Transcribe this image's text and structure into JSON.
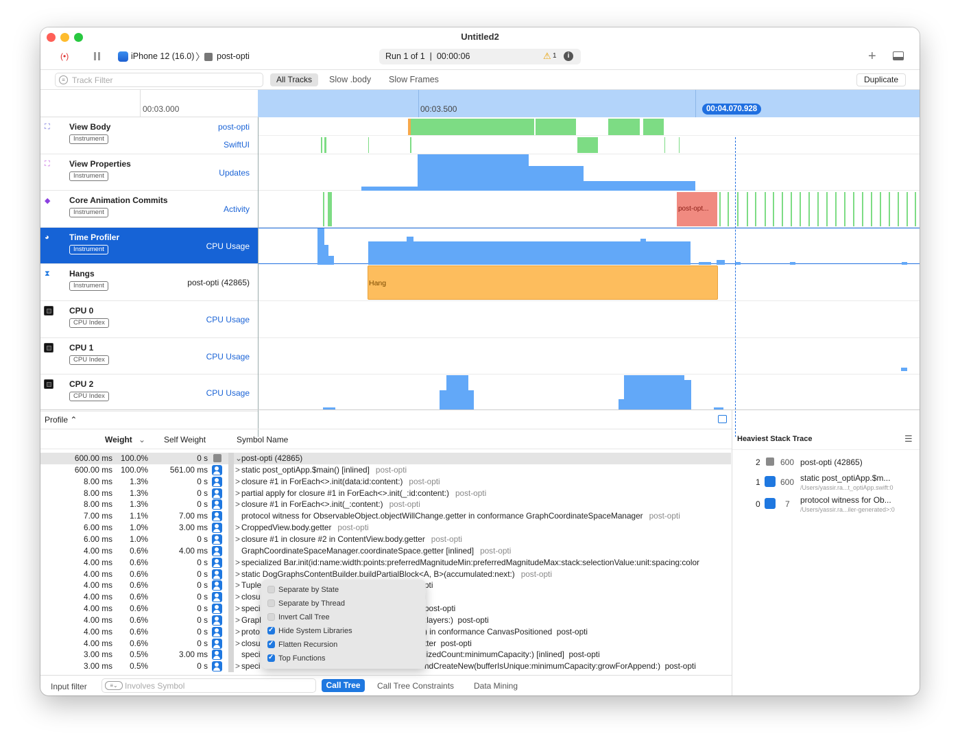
{
  "window": {
    "title": "Untitled2"
  },
  "toolbar": {
    "record_glyph": "(•)",
    "device": "iPhone 12 (16.0)",
    "target": "post-opti",
    "run_status": "Run 1 of 1  |  00:00:06",
    "warning_count": "1",
    "add_glyph": "+"
  },
  "filter": {
    "placeholder": "Track Filter",
    "scopes": [
      "All Tracks",
      "Slow .body",
      "Slow Frames"
    ],
    "duplicate": "Duplicate"
  },
  "ruler": {
    "ticks": [
      "00:03.000",
      "00:03.500"
    ],
    "playhead": "00:04.070.928"
  },
  "tracks": [
    {
      "name": "View Body",
      "badge": "Instrument",
      "sub1": "post-opti",
      "sub2": "SwiftUI",
      "icon": "view-body-icon"
    },
    {
      "name": "View Properties",
      "badge": "Instrument",
      "sub1": "Updates",
      "icon": "view-properties-icon"
    },
    {
      "name": "Core Animation Commits",
      "badge": "Instrument",
      "sub1": "Activity",
      "icon": "core-animation-icon"
    },
    {
      "name": "Time Profiler",
      "badge": "Instrument",
      "sub1": "CPU Usage",
      "icon": "time-profiler-icon"
    },
    {
      "name": "Hangs",
      "badge": "Instrument",
      "sub1": "post-opti (42865)",
      "icon": "hangs-icon"
    },
    {
      "name": "CPU 0",
      "badge": "CPU Index",
      "sub1": "CPU Usage",
      "icon": "cpu-icon"
    },
    {
      "name": "CPU 1",
      "badge": "CPU Index",
      "sub1": "CPU Usage",
      "icon": "cpu-icon"
    },
    {
      "name": "CPU 2",
      "badge": "CPU Index",
      "sub1": "CPU Usage",
      "icon": "cpu-icon"
    }
  ],
  "lane_labels": {
    "ca_commit": "post-opt...",
    "hang": "Hang"
  },
  "profile": {
    "mode": "Profile ⌃",
    "col_weight": "Weight",
    "col_self": "Self Weight",
    "col_symbol": "Symbol Name"
  },
  "rows": [
    {
      "w": "600.00 ms",
      "p": "100.0%",
      "s": "0 s",
      "sym": "post-opti (42865)",
      "lib": "",
      "arrow": "⌄",
      "kind": "g"
    },
    {
      "w": "600.00 ms",
      "p": "100.0%",
      "s": "561.00 ms",
      "sym": "static post_optiApp.$main() [inlined]",
      "lib": "post-opti",
      "arrow": ">",
      "kind": "u"
    },
    {
      "w": "8.00 ms",
      "p": "1.3%",
      "s": "0 s",
      "sym": "closure #1 in ForEach<>.init(data:id:content:)",
      "lib": "post-opti",
      "arrow": ">",
      "kind": "u"
    },
    {
      "w": "8.00 ms",
      "p": "1.3%",
      "s": "0 s",
      "sym": "partial apply for closure #1 in ForEach<>.init(_:id:content:)",
      "lib": "post-opti",
      "arrow": ">",
      "kind": "u"
    },
    {
      "w": "8.00 ms",
      "p": "1.3%",
      "s": "0 s",
      "sym": "closure #1 in ForEach<>.init(_:content:)",
      "lib": "post-opti",
      "arrow": ">",
      "kind": "u"
    },
    {
      "w": "7.00 ms",
      "p": "1.1%",
      "s": "7.00 ms",
      "sym": "protocol witness for ObservableObject.objectWillChange.getter in conformance GraphCoordinateSpaceManager",
      "lib": "post-opti",
      "arrow": " ",
      "kind": "u"
    },
    {
      "w": "6.00 ms",
      "p": "1.0%",
      "s": "3.00 ms",
      "sym": "CroppedView.body.getter",
      "lib": "post-opti",
      "arrow": ">",
      "kind": "u"
    },
    {
      "w": "6.00 ms",
      "p": "1.0%",
      "s": "0 s",
      "sym": "closure #1 in closure #2 in ContentView.body.getter",
      "lib": "post-opti",
      "arrow": ">",
      "kind": "u"
    },
    {
      "w": "4.00 ms",
      "p": "0.6%",
      "s": "4.00 ms",
      "sym": "GraphCoordinateSpaceManager.coordinateSpace.getter [inlined]",
      "lib": "post-opti",
      "arrow": " ",
      "kind": "u"
    },
    {
      "w": "4.00 ms",
      "p": "0.6%",
      "s": "0 s",
      "sym": "specialized Bar.init(id:name:width:points:preferredMagnitudeMin:preferredMagnitudeMax:stack:selectionValue:unit:spacing:color",
      "lib": "",
      "arrow": ">",
      "kind": "u"
    },
    {
      "w": "4.00 ms",
      "p": "0.6%",
      "s": "0 s",
      "sym": "static DogGraphsContentBuilder.buildPartialBlock<A, B>(accumulated:next:)",
      "lib": "post-opti",
      "arrow": ">",
      "kind": "u"
    },
    {
      "w": "4.00 ms",
      "p": "0.6%",
      "s": "0 s",
      "sym": "Tuple",
      "tail": "pti",
      "arrow": ">",
      "kind": "u"
    },
    {
      "w": "4.00 ms",
      "p": "0.6%",
      "s": "0 s",
      "sym": "closu",
      "tail": "i",
      "arrow": ">",
      "kind": "u"
    },
    {
      "w": "4.00 ms",
      "p": "0.6%",
      "s": "0 s",
      "sym": "speci",
      "tail": "post-opti",
      "arrow": ">",
      "kind": "u"
    },
    {
      "w": "4.00 ms",
      "p": "0.6%",
      "s": "0 s",
      "sym": "Grapl",
      "tail": ":layers:)  post-opti",
      "arrow": ">",
      "kind": "u"
    },
    {
      "w": "4.00 ms",
      "p": "0.6%",
      "s": "0 s",
      "sym": "proto",
      "tail": ") in conformance CanvasPositioned  post-opti",
      "arrow": ">",
      "kind": "u"
    },
    {
      "w": "4.00 ms",
      "p": "0.6%",
      "s": "0 s",
      "sym": "closu",
      "tail": "tter  post-opti",
      "arrow": ">",
      "kind": "u"
    },
    {
      "w": "3.00 ms",
      "p": "0.5%",
      "s": "3.00 ms",
      "sym": "speci",
      "tail": "lizedCount:minimumCapacity:) [inlined]  post-opti",
      "arrow": " ",
      "kind": "u"
    },
    {
      "w": "3.00 ms",
      "p": "0.5%",
      "s": "0 s",
      "sym": "speci",
      "tail": "ndCreateNew(bufferIsUnique:minimumCapacity:growForAppend:)  post-opti",
      "arrow": ">",
      "kind": "u"
    }
  ],
  "popup": [
    {
      "label": "Separate by State",
      "checked": false
    },
    {
      "label": "Separate by Thread",
      "checked": false
    },
    {
      "label": "Invert Call Tree",
      "checked": false
    },
    {
      "label": "Hide System Libraries",
      "checked": true
    },
    {
      "label": "Flatten Recursion",
      "checked": true
    },
    {
      "label": "Top Functions",
      "checked": true
    }
  ],
  "footer": {
    "input_filter": "Input filter",
    "involves": "Involves Symbol",
    "tabs": [
      "Call Tree",
      "Call Tree Constraints",
      "Data Mining"
    ]
  },
  "heaviest": {
    "title": "Heaviest Stack Trace",
    "items": [
      {
        "idx": "2",
        "count": "600",
        "name": "post-opti (42865)",
        "path": ""
      },
      {
        "idx": "1",
        "count": "600",
        "name": "static post_optiApp.$m...",
        "path": "/Users/yassir.ra...t_optiApp.swift:0"
      },
      {
        "idx": "0",
        "count": "7",
        "name": "protocol witness for Ob...",
        "path": "/Users/yassir.ra...iler-generated>:0"
      }
    ]
  },
  "colors": {
    "accent": "#1f78e0",
    "green": "#7ddc84",
    "blue": "#62a8f8",
    "orange": "#fdbd5d",
    "red": "#f08a80"
  }
}
